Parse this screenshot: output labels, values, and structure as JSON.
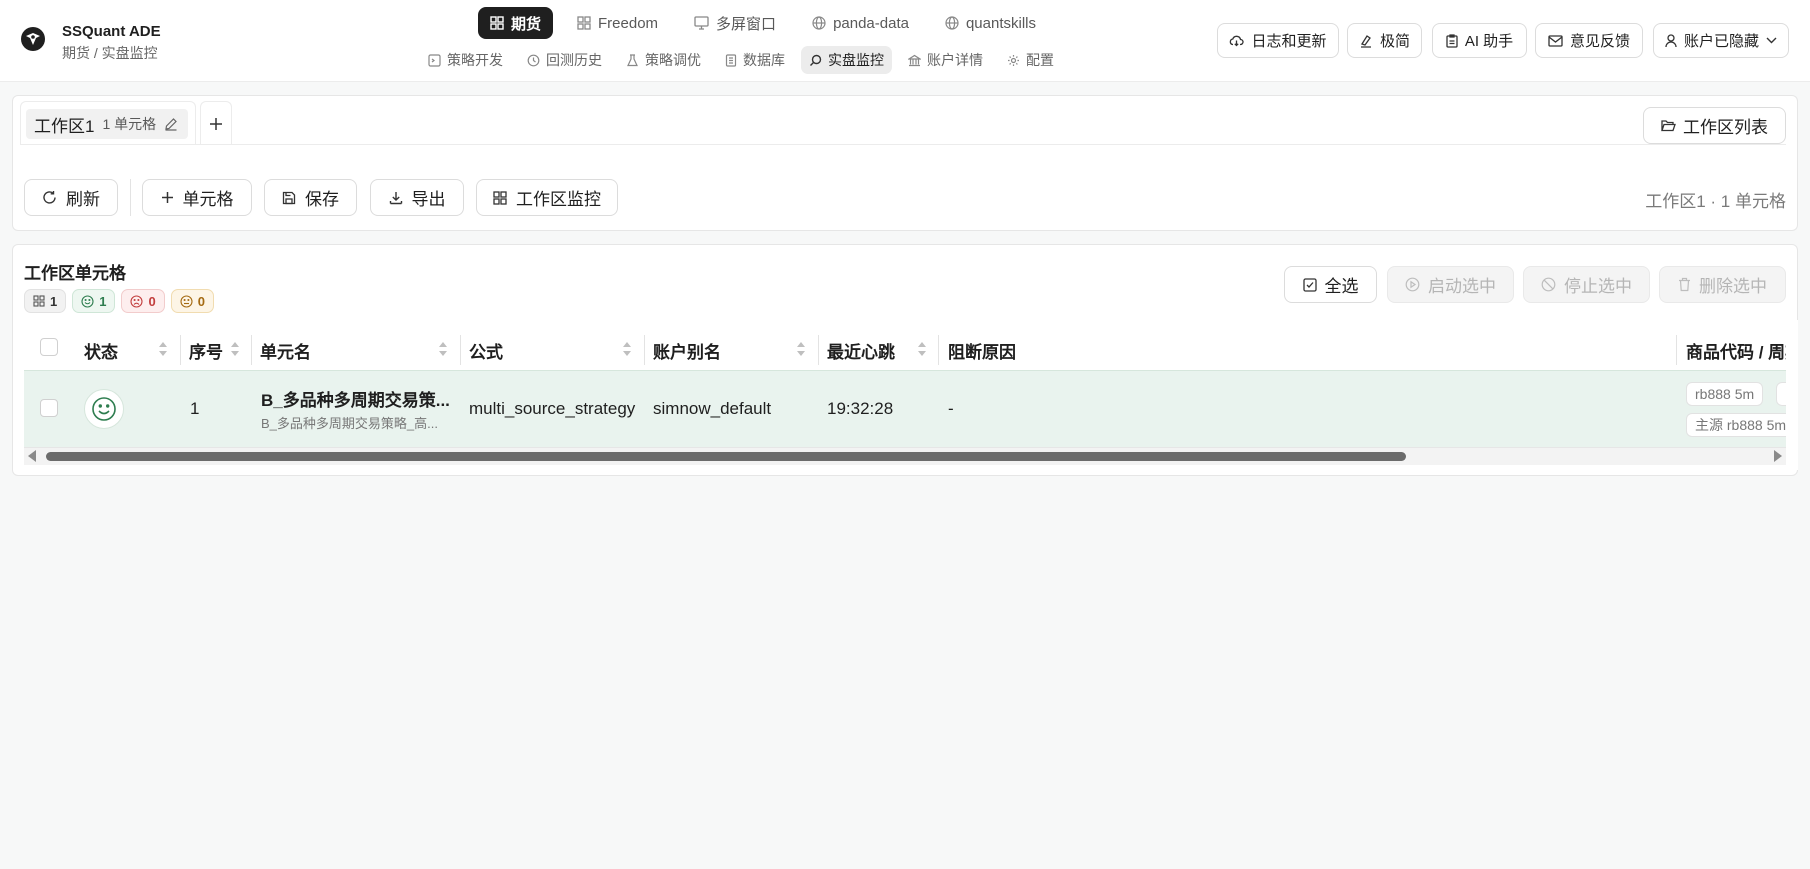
{
  "app": {
    "title": "SSQuant ADE",
    "breadcrumb": "期货 / 实盘监控"
  },
  "nav_top": [
    {
      "label": "期货",
      "icon": "grid-icon",
      "active": true
    },
    {
      "label": "Freedom",
      "icon": "grid-icon"
    },
    {
      "label": "多屏窗口",
      "icon": "monitor-icon"
    },
    {
      "label": "panda-data",
      "icon": "globe-icon"
    },
    {
      "label": "quantskills",
      "icon": "globe-icon"
    }
  ],
  "nav_sub": [
    {
      "label": "策略开发",
      "icon": "terminal-icon"
    },
    {
      "label": "回测历史",
      "icon": "history-icon"
    },
    {
      "label": "策略调优",
      "icon": "flask-icon"
    },
    {
      "label": "数据库",
      "icon": "database-icon"
    },
    {
      "label": "实盘监控",
      "icon": "search-icon",
      "active": true
    },
    {
      "label": "账户详情",
      "icon": "bank-icon"
    },
    {
      "label": "配置",
      "icon": "gear-icon"
    }
  ],
  "header_buttons": {
    "logs": "日志和更新",
    "minimal": "极简",
    "ai": "AI 助手",
    "feedback": "意见反馈",
    "account": "账户已隐藏"
  },
  "workspace": {
    "tab_name": "工作区1",
    "tab_count": "1 单元格",
    "list_button": "工作区列表",
    "summary": "工作区1 · 1 单元格"
  },
  "toolbar": {
    "refresh": "刷新",
    "add_cell": "单元格",
    "save": "保存",
    "export": "导出",
    "monitor": "工作区监控"
  },
  "cells_panel": {
    "title": "工作区单元格",
    "badges": {
      "total": "1",
      "ok": "1",
      "error": "0",
      "neutral": "0"
    },
    "select_all": "全选",
    "start_selected": "启动选中",
    "stop_selected": "停止选中",
    "delete_selected": "删除选中"
  },
  "table": {
    "columns": {
      "status": "状态",
      "index": "序号",
      "cell_name": "单元名",
      "formula": "公式",
      "account_alias": "账户别名",
      "heartbeat": "最近心跳",
      "block_reason": "阻断原因",
      "symbol_period": "商品代码 / 周期"
    },
    "rows": [
      {
        "index": "1",
        "cell_name": "B_多品种多周期交易策...",
        "cell_sub": "B_多品种多周期交易策略_高...",
        "formula": "multi_source_strategy",
        "account_alias": "simnow_default",
        "heartbeat": "19:32:28",
        "block_reason": "-",
        "tag1": "rb888 5m",
        "tag2": "主源 rb888 5m"
      }
    ]
  },
  "colors": {
    "accent_dark": "#1f1f1f",
    "row_highlight": "#e9f3ee",
    "status_green": "#2e7d4f"
  }
}
